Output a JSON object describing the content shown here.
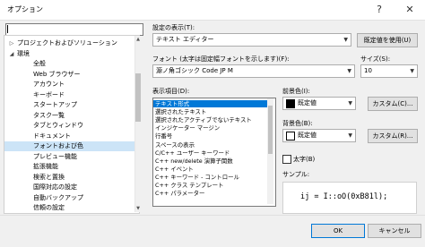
{
  "window": {
    "title": "オプション",
    "help_glyph": "?",
    "close_glyph": "✕"
  },
  "search": {
    "value": "",
    "placeholder": ""
  },
  "tree": {
    "items": [
      {
        "label": "プロジェクトおよびソリューション",
        "arrow": "▷",
        "level": 1
      },
      {
        "label": "環境",
        "arrow": "◢",
        "level": 1
      },
      {
        "label": "全般",
        "arrow": "",
        "level": 2
      },
      {
        "label": "Web ブラウザー",
        "arrow": "",
        "level": 2
      },
      {
        "label": "アカウント",
        "arrow": "",
        "level": 2
      },
      {
        "label": "キーボード",
        "arrow": "",
        "level": 2
      },
      {
        "label": "スタートアップ",
        "arrow": "",
        "level": 2
      },
      {
        "label": "タスク一覧",
        "arrow": "",
        "level": 2
      },
      {
        "label": "タブとウィンドウ",
        "arrow": "",
        "level": 2
      },
      {
        "label": "ドキュメント",
        "arrow": "",
        "level": 2
      },
      {
        "label": "フォントおよび色",
        "arrow": "",
        "level": 2,
        "selected": true
      },
      {
        "label": "プレビュー機能",
        "arrow": "",
        "level": 2
      },
      {
        "label": "拡張機能",
        "arrow": "",
        "level": 2
      },
      {
        "label": "検索と置換",
        "arrow": "",
        "level": 2
      },
      {
        "label": "国際対応の設定",
        "arrow": "",
        "level": 2
      },
      {
        "label": "自動バックアップ",
        "arrow": "",
        "level": 2
      },
      {
        "label": "信頼の設定",
        "arrow": "",
        "level": 2
      }
    ]
  },
  "settings_for": {
    "label": "設定の表示(T):",
    "value": "テキスト エディター"
  },
  "default_button": "既定値を使用(U)",
  "font": {
    "label": "フォント (太字は固定幅フォントを示します)(F):",
    "value": "源ノ角ゴシック Code JP M"
  },
  "size": {
    "label": "サイズ(S):",
    "value": "10"
  },
  "display_items": {
    "label": "表示項目(D):",
    "items": [
      {
        "label": "テキスト形式",
        "selected": true
      },
      {
        "label": "選択されたテキスト"
      },
      {
        "label": "選択されたアクティブでないテキスト"
      },
      {
        "label": "インジケーター マージン"
      },
      {
        "label": "行番号"
      },
      {
        "label": "スペースの表示"
      },
      {
        "label": "C/C++ ユーザー キーワード"
      },
      {
        "label": "C++ new/delete 演算子関数"
      },
      {
        "label": "C++ イベント"
      },
      {
        "label": "C++ キーワード - コントロール"
      },
      {
        "label": "C++ クラス テンプレート"
      },
      {
        "label": "C++ パラメーター"
      }
    ]
  },
  "foreground": {
    "label": "前景色(I):",
    "value": "既定値",
    "swatch_color": "#000000",
    "custom_button": "カスタム(C)..."
  },
  "background": {
    "label": "背景色(B):",
    "value": "既定値",
    "swatch_color": "#ffffff",
    "custom_button": "カスタム(R)..."
  },
  "bold": {
    "label": "太字(B)",
    "checked": false
  },
  "sample": {
    "label": "サンプル:",
    "text": "ij = I::oO(0xB81l);"
  },
  "buttons": {
    "ok": "OK",
    "cancel": "キャンセル"
  }
}
